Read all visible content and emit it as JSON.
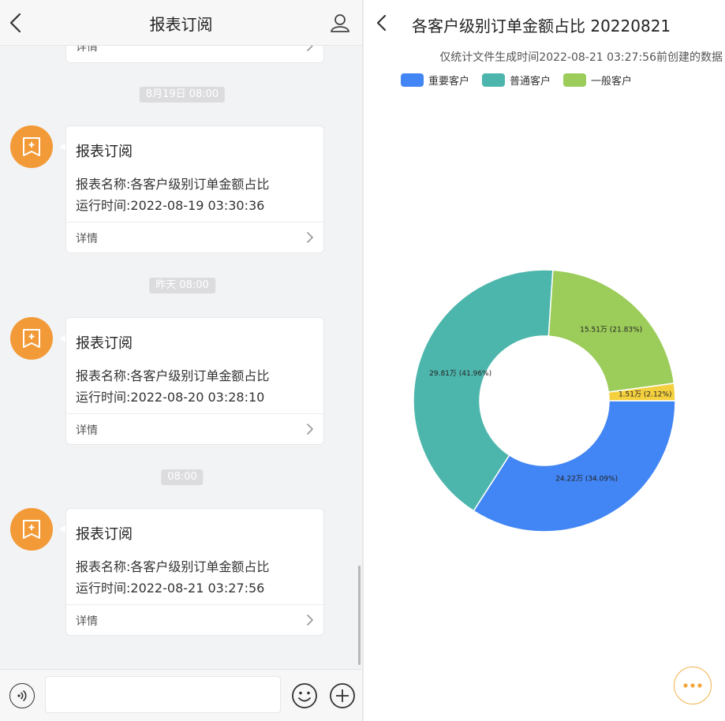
{
  "left_panel": {
    "header": {
      "title": "报表订阅"
    },
    "timestamps": [
      "8月19日 08:00",
      "昨天 08:00",
      "08:00"
    ],
    "detail_label": "详情",
    "messages": [
      {
        "title": "报表订阅",
        "report_name": "报表名称:各客户级别订单金额占比",
        "run_time": "运行时间:2022-08-19 03:30:36"
      },
      {
        "title": "报表订阅",
        "report_name": "报表名称:各客户级别订单金额占比",
        "run_time": "运行时间:2022-08-20 03:28:10"
      },
      {
        "title": "报表订阅",
        "report_name": "报表名称:各客户级别订单金额占比",
        "run_time": "运行时间:2022-08-21 03:27:56"
      }
    ],
    "input": {
      "value": "",
      "placeholder": ""
    }
  },
  "right_panel": {
    "header": {
      "title": "各客户级别订单金额占比 20220821"
    },
    "subtitle": "仅统计文件生成时间2022-08-21 03:27:56前创建的数据",
    "more_icon": "more-dots-icon"
  },
  "colors": {
    "accent_orange": "#f39a38",
    "important": "#4285f4",
    "normal": "#4db6ac",
    "general": "#9ccc5a",
    "other": "#f4d03f"
  },
  "chart_data": {
    "type": "pie",
    "donut": true,
    "legend": {
      "placement": "top-left",
      "items": [
        "重要客户",
        "普通客户",
        "一般客户"
      ]
    },
    "series": [
      {
        "name": "重要客户",
        "value": 24.22,
        "percent": 34.09,
        "label": "24.22万 (34.09%)",
        "color": "#4285f4"
      },
      {
        "name": "普通客户",
        "value": 29.81,
        "percent": 41.96,
        "label": "29.81万 (41.96%)",
        "color": "#4db6ac"
      },
      {
        "name": "一般客户",
        "value": 15.51,
        "percent": 21.83,
        "label": "15.51万 (21.83%)",
        "color": "#9ccc5a"
      },
      {
        "value": 1.51,
        "percent": 2.12,
        "label": "1.51万 (2.12%)",
        "color": "#f4d03f"
      }
    ]
  }
}
